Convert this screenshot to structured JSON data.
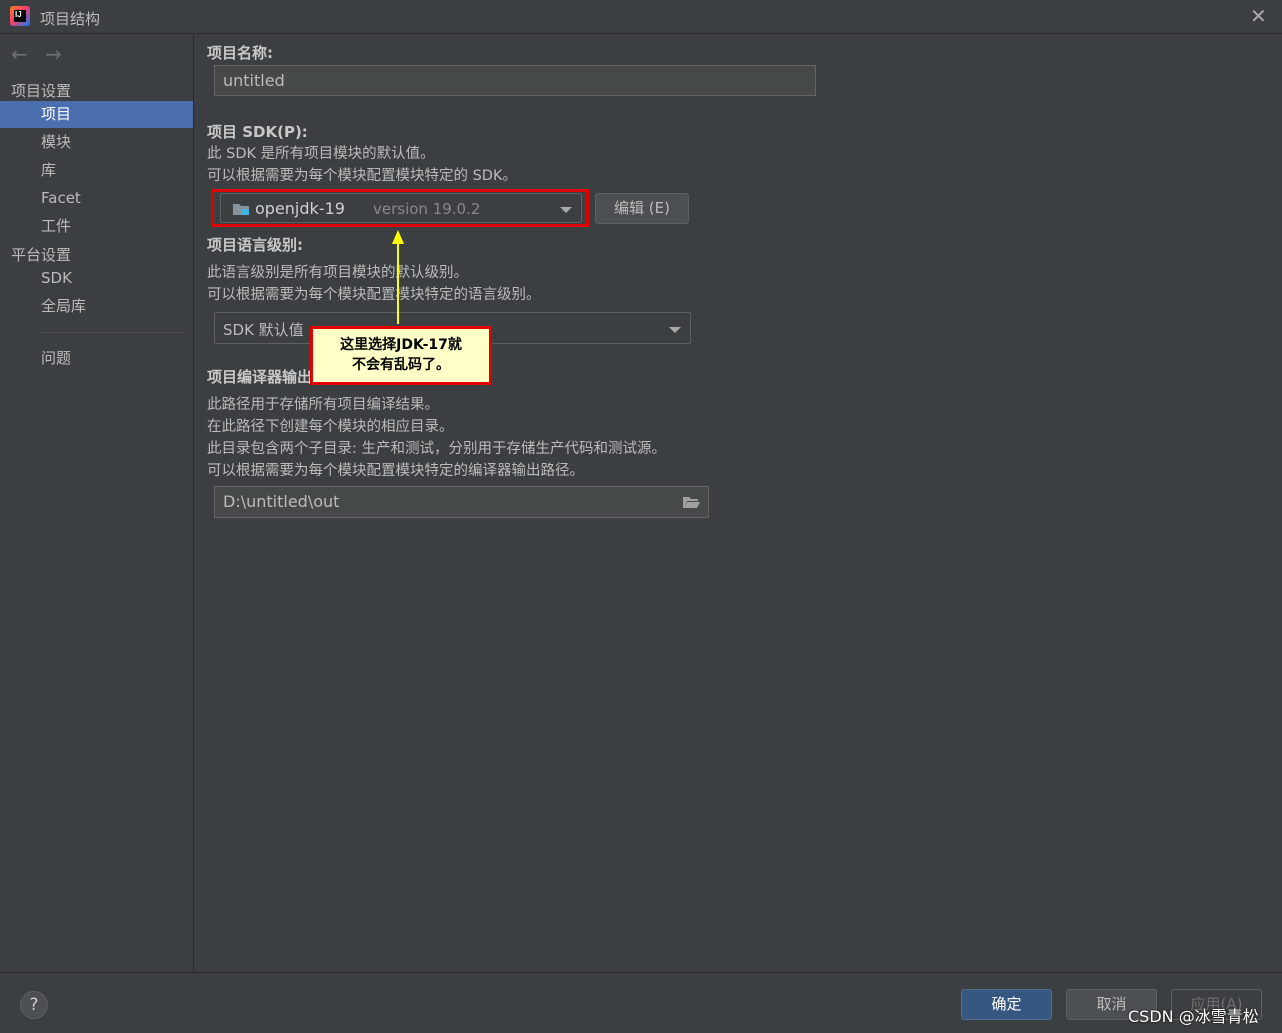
{
  "window": {
    "title": "项目结构",
    "close_glyph": "✕"
  },
  "nav": {
    "back_glyph": "←",
    "forward_glyph": "→"
  },
  "sidebar": {
    "project_settings_header": "项目设置",
    "project_settings_items": [
      "项目",
      "模块",
      "库",
      "Facet",
      "工件"
    ],
    "platform_settings_header": "平台设置",
    "platform_settings_items": [
      "SDK",
      "全局库"
    ],
    "problems": "问题",
    "selected": "项目"
  },
  "project_name": {
    "label": "项目名称:",
    "value": "untitled"
  },
  "project_sdk": {
    "label": "项目 SDK(P):",
    "desc1": "此 SDK 是所有项目模块的默认值。",
    "desc2": "可以根据需要为每个模块配置模块特定的 SDK。",
    "selected_name": "openjdk-19",
    "selected_version": "version 19.0.2",
    "edit_button": "编辑 (E)"
  },
  "language_level": {
    "label": "项目语言级别:",
    "desc1": "此语言级别是所有项目模块的默认级别。",
    "desc2": "可以根据需要为每个模块配置模块特定的语言级别。",
    "value": "SDK 默认值"
  },
  "compiler_output": {
    "label": "项目编译器输出",
    "desc1": "此路径用于存储所有项目编译结果。",
    "desc2": "在此路径下创建每个模块的相应目录。",
    "desc3": "此目录包含两个子目录: 生产和测试，分别用于存储生产代码和测试源。",
    "desc4": "可以根据需要为每个模块配置模块特定的编译器输出路径。",
    "path": "D:\\untitled\\out"
  },
  "annotation": {
    "line1": "这里选择JDK-17就",
    "line2": "不会有乱码了。"
  },
  "footer": {
    "help_glyph": "?",
    "ok": "确定",
    "cancel": "取消",
    "apply": "应用(A)"
  },
  "watermark": "CSDN @冰雪青松",
  "colors": {
    "accent_selected": "#4b6eaf",
    "annotation_red": "#e00000",
    "annotation_arrow": "#ffff00",
    "primary_button": "#365880"
  }
}
